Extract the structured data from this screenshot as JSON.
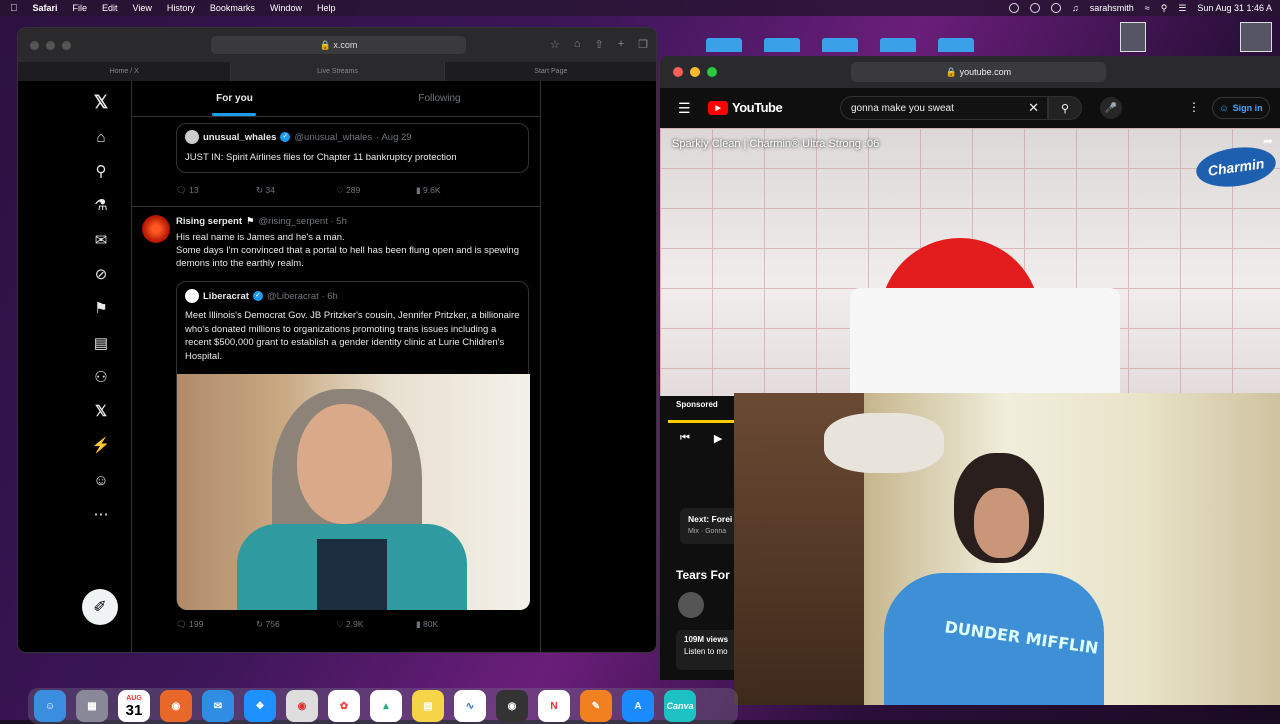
{
  "menubar": {
    "app": "Safari",
    "items": [
      "File",
      "Edit",
      "View",
      "History",
      "Bookmarks",
      "Window",
      "Help"
    ],
    "user": "sarahsmith",
    "datetime": "Sun Aug 31  1:46 A"
  },
  "left_browser": {
    "url": "x.com",
    "tabs": [
      "Home / X",
      "Live Streams",
      "Start Page"
    ]
  },
  "x": {
    "feed_tabs": [
      "For you",
      "Following"
    ],
    "tweet1_quote": {
      "name": "unusual_whales",
      "handle": "@unusual_whales",
      "date": "· Aug 29",
      "text": "JUST IN: Spirit Airlines files for Chapter 11 bankruptcy protection"
    },
    "tweet1_actions": {
      "replies": "13",
      "reposts": "34",
      "likes": "289",
      "views": "9.6K"
    },
    "tweet2": {
      "name": "Rising serpent",
      "handle": "@rising_serpent · 5h",
      "text1": "His real name is James and he's a man.",
      "text2": "Some days I'm convinced that a portal to hell has been flung open and is spewing demons into the earthly realm."
    },
    "tweet2_quote": {
      "name": "Liberacrat",
      "handle": "@Liberacrat · 6h",
      "text": "Meet Illinois's Democrat Gov. JB Pritzker's cousin, Jennifer Pritzker, a billionaire who's donated millions to organizations promoting trans issues including a recent $500,000 grant to establish a gender identity clinic at Lurie Children's Hospital."
    },
    "tweet2_actions": {
      "replies": "199",
      "reposts": "756",
      "likes": "2.9K",
      "views": "80K"
    }
  },
  "right_browser": {
    "url": "youtube.com",
    "logo": "YouTube",
    "search_value": "gonna make you sweat",
    "signin": "Sign in",
    "video_title": "Sparkly Clean | Charmin® Ultra Strong :06",
    "brand": "Charmin",
    "sponsored": "Sponsored",
    "next_label": "Next:",
    "next_text": "Forei",
    "next_sub": "Mix · Gonna",
    "section": "Tears For",
    "views": "109M views",
    "listen": "Listen to mo"
  },
  "webcam": {
    "shirt_text": "DUNDER MIFFLIN"
  },
  "dock": {
    "date_month": "AUG",
    "date_day": "31",
    "canva": "Canva"
  },
  "colors": {
    "x_blue": "#1d9bf0",
    "yt_red": "#ff0000"
  }
}
